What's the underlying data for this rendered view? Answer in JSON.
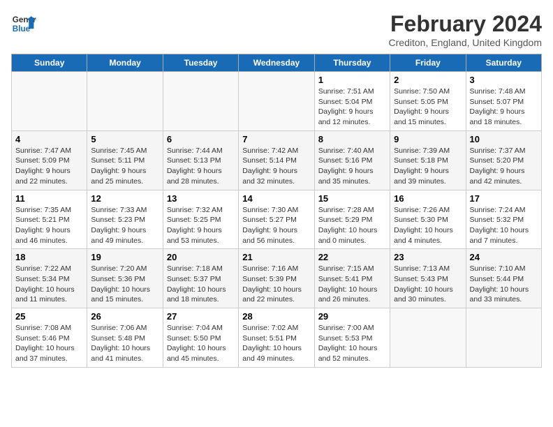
{
  "header": {
    "logo_line1": "General",
    "logo_line2": "Blue",
    "title": "February 2024",
    "subtitle": "Crediton, England, United Kingdom"
  },
  "days_of_week": [
    "Sunday",
    "Monday",
    "Tuesday",
    "Wednesday",
    "Thursday",
    "Friday",
    "Saturday"
  ],
  "weeks": [
    [
      {
        "day": "",
        "content": ""
      },
      {
        "day": "",
        "content": ""
      },
      {
        "day": "",
        "content": ""
      },
      {
        "day": "",
        "content": ""
      },
      {
        "day": "1",
        "content": "Sunrise: 7:51 AM\nSunset: 5:04 PM\nDaylight: 9 hours\nand 12 minutes."
      },
      {
        "day": "2",
        "content": "Sunrise: 7:50 AM\nSunset: 5:05 PM\nDaylight: 9 hours\nand 15 minutes."
      },
      {
        "day": "3",
        "content": "Sunrise: 7:48 AM\nSunset: 5:07 PM\nDaylight: 9 hours\nand 18 minutes."
      }
    ],
    [
      {
        "day": "4",
        "content": "Sunrise: 7:47 AM\nSunset: 5:09 PM\nDaylight: 9 hours\nand 22 minutes."
      },
      {
        "day": "5",
        "content": "Sunrise: 7:45 AM\nSunset: 5:11 PM\nDaylight: 9 hours\nand 25 minutes."
      },
      {
        "day": "6",
        "content": "Sunrise: 7:44 AM\nSunset: 5:13 PM\nDaylight: 9 hours\nand 28 minutes."
      },
      {
        "day": "7",
        "content": "Sunrise: 7:42 AM\nSunset: 5:14 PM\nDaylight: 9 hours\nand 32 minutes."
      },
      {
        "day": "8",
        "content": "Sunrise: 7:40 AM\nSunset: 5:16 PM\nDaylight: 9 hours\nand 35 minutes."
      },
      {
        "day": "9",
        "content": "Sunrise: 7:39 AM\nSunset: 5:18 PM\nDaylight: 9 hours\nand 39 minutes."
      },
      {
        "day": "10",
        "content": "Sunrise: 7:37 AM\nSunset: 5:20 PM\nDaylight: 9 hours\nand 42 minutes."
      }
    ],
    [
      {
        "day": "11",
        "content": "Sunrise: 7:35 AM\nSunset: 5:21 PM\nDaylight: 9 hours\nand 46 minutes."
      },
      {
        "day": "12",
        "content": "Sunrise: 7:33 AM\nSunset: 5:23 PM\nDaylight: 9 hours\nand 49 minutes."
      },
      {
        "day": "13",
        "content": "Sunrise: 7:32 AM\nSunset: 5:25 PM\nDaylight: 9 hours\nand 53 minutes."
      },
      {
        "day": "14",
        "content": "Sunrise: 7:30 AM\nSunset: 5:27 PM\nDaylight: 9 hours\nand 56 minutes."
      },
      {
        "day": "15",
        "content": "Sunrise: 7:28 AM\nSunset: 5:29 PM\nDaylight: 10 hours\nand 0 minutes."
      },
      {
        "day": "16",
        "content": "Sunrise: 7:26 AM\nSunset: 5:30 PM\nDaylight: 10 hours\nand 4 minutes."
      },
      {
        "day": "17",
        "content": "Sunrise: 7:24 AM\nSunset: 5:32 PM\nDaylight: 10 hours\nand 7 minutes."
      }
    ],
    [
      {
        "day": "18",
        "content": "Sunrise: 7:22 AM\nSunset: 5:34 PM\nDaylight: 10 hours\nand 11 minutes."
      },
      {
        "day": "19",
        "content": "Sunrise: 7:20 AM\nSunset: 5:36 PM\nDaylight: 10 hours\nand 15 minutes."
      },
      {
        "day": "20",
        "content": "Sunrise: 7:18 AM\nSunset: 5:37 PM\nDaylight: 10 hours\nand 18 minutes."
      },
      {
        "day": "21",
        "content": "Sunrise: 7:16 AM\nSunset: 5:39 PM\nDaylight: 10 hours\nand 22 minutes."
      },
      {
        "day": "22",
        "content": "Sunrise: 7:15 AM\nSunset: 5:41 PM\nDaylight: 10 hours\nand 26 minutes."
      },
      {
        "day": "23",
        "content": "Sunrise: 7:13 AM\nSunset: 5:43 PM\nDaylight: 10 hours\nand 30 minutes."
      },
      {
        "day": "24",
        "content": "Sunrise: 7:10 AM\nSunset: 5:44 PM\nDaylight: 10 hours\nand 33 minutes."
      }
    ],
    [
      {
        "day": "25",
        "content": "Sunrise: 7:08 AM\nSunset: 5:46 PM\nDaylight: 10 hours\nand 37 minutes."
      },
      {
        "day": "26",
        "content": "Sunrise: 7:06 AM\nSunset: 5:48 PM\nDaylight: 10 hours\nand 41 minutes."
      },
      {
        "day": "27",
        "content": "Sunrise: 7:04 AM\nSunset: 5:50 PM\nDaylight: 10 hours\nand 45 minutes."
      },
      {
        "day": "28",
        "content": "Sunrise: 7:02 AM\nSunset: 5:51 PM\nDaylight: 10 hours\nand 49 minutes."
      },
      {
        "day": "29",
        "content": "Sunrise: 7:00 AM\nSunset: 5:53 PM\nDaylight: 10 hours\nand 52 minutes."
      },
      {
        "day": "",
        "content": ""
      },
      {
        "day": "",
        "content": ""
      }
    ]
  ]
}
